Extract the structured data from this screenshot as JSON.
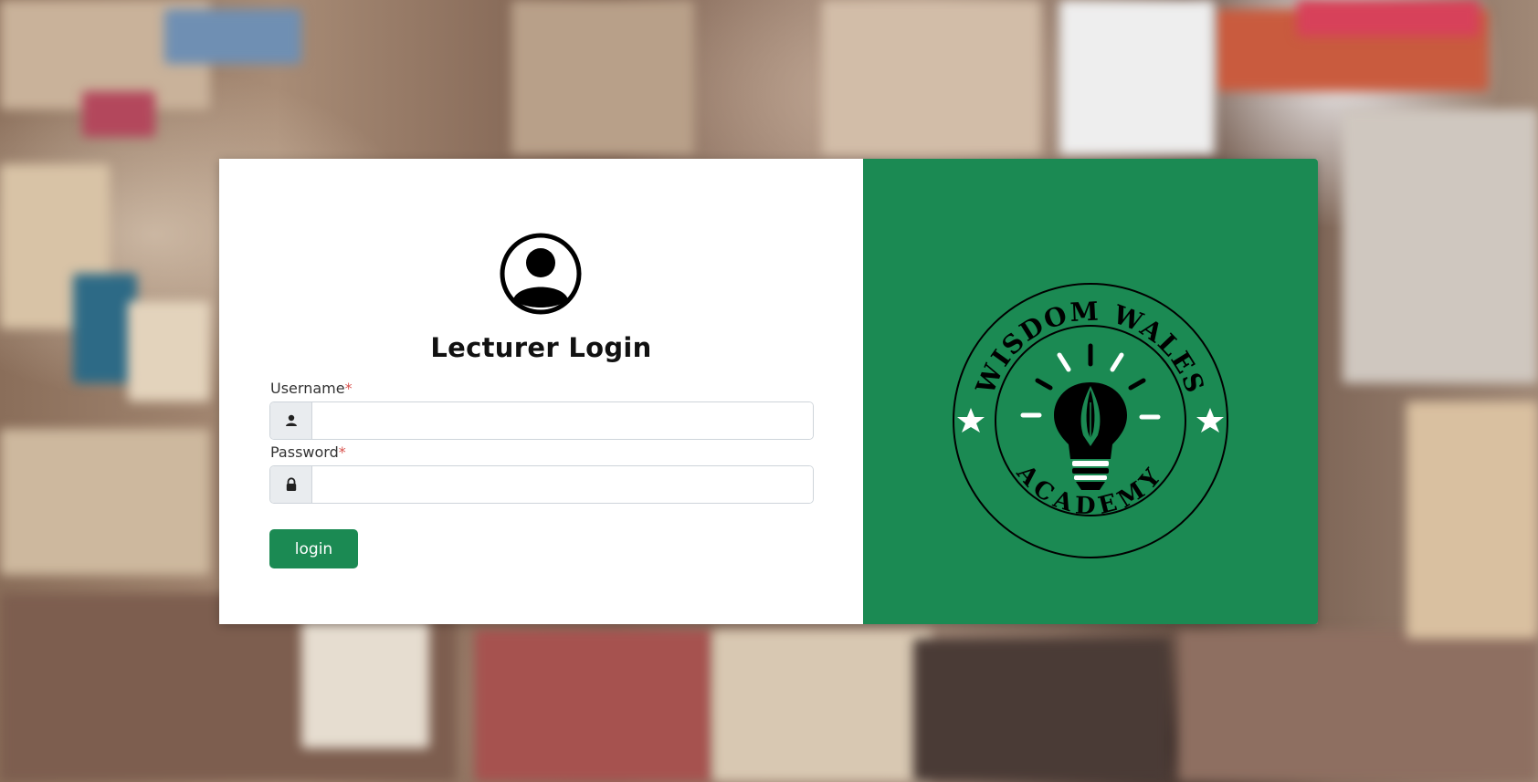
{
  "page": {
    "title": "Lecturer Login"
  },
  "form": {
    "username_label": "Username",
    "password_label": "Password",
    "required_marker": "*",
    "username_value": "",
    "password_value": "",
    "login_label": "login"
  },
  "icons": {
    "avatar": "user-circle-icon",
    "username": "user-icon",
    "password": "lock-icon",
    "logo": "lightbulb-pen-logo"
  },
  "logo": {
    "top_text": "WISDOM WALES",
    "bottom_text": "ACADEMY"
  },
  "colors": {
    "brand_green": "#1b8a53",
    "required_red": "#d9534f"
  }
}
